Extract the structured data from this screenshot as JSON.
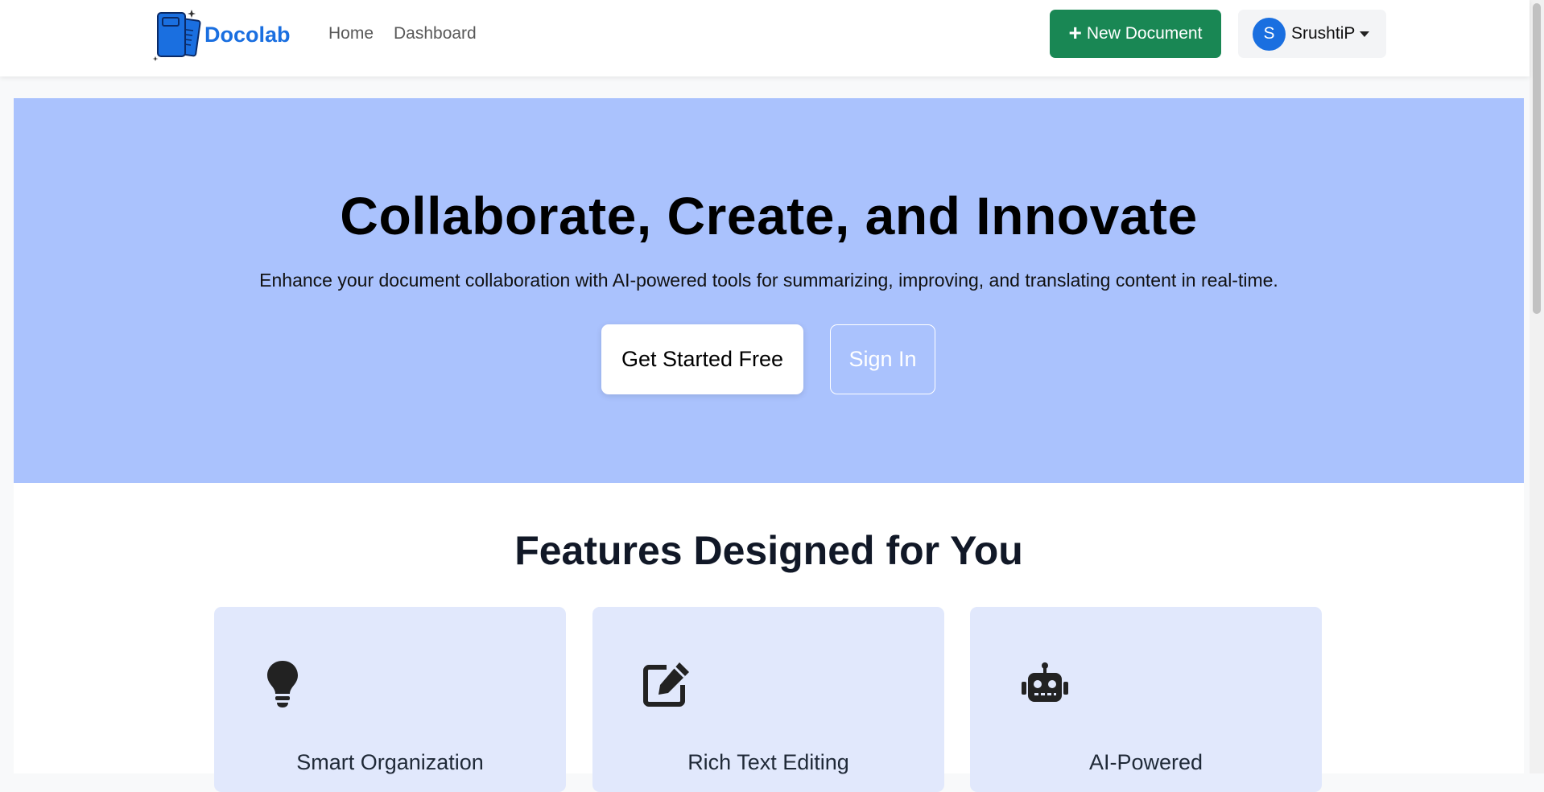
{
  "navbar": {
    "brand": "Docolab",
    "links": [
      "Home",
      "Dashboard"
    ],
    "new_document_label": "New Document",
    "user": {
      "initial": "S",
      "name": "SrushtiP"
    }
  },
  "hero": {
    "title": "Collaborate, Create, and Innovate",
    "subtitle": "Enhance your document collaboration with AI-powered tools for summarizing, improving, and translating content in real-time.",
    "primary_cta": "Get Started Free",
    "secondary_cta": "Sign In"
  },
  "features": {
    "title": "Features Designed for You",
    "cards": [
      {
        "icon": "lightbulb-icon",
        "title": "Smart Organization"
      },
      {
        "icon": "edit-icon",
        "title": "Rich Text Editing"
      },
      {
        "icon": "robot-icon",
        "title": "AI-Powered"
      }
    ]
  },
  "colors": {
    "brand": "#1a6fe0",
    "success": "#198754",
    "hero_bg": "#aac2fd",
    "card_bg": "#e1e8fc"
  }
}
